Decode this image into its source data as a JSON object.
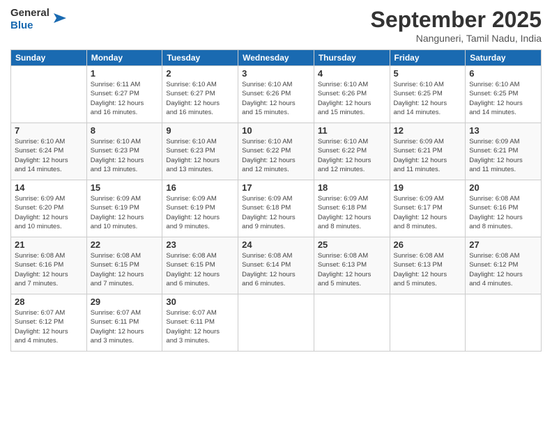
{
  "logo": {
    "general": "General",
    "blue": "Blue"
  },
  "title": "September 2025",
  "subtitle": "Nanguneri, Tamil Nadu, India",
  "days_header": [
    "Sunday",
    "Monday",
    "Tuesday",
    "Wednesday",
    "Thursday",
    "Friday",
    "Saturday"
  ],
  "weeks": [
    [
      {
        "day": "",
        "info": ""
      },
      {
        "day": "1",
        "info": "Sunrise: 6:11 AM\nSunset: 6:27 PM\nDaylight: 12 hours\nand 16 minutes."
      },
      {
        "day": "2",
        "info": "Sunrise: 6:10 AM\nSunset: 6:27 PM\nDaylight: 12 hours\nand 16 minutes."
      },
      {
        "day": "3",
        "info": "Sunrise: 6:10 AM\nSunset: 6:26 PM\nDaylight: 12 hours\nand 15 minutes."
      },
      {
        "day": "4",
        "info": "Sunrise: 6:10 AM\nSunset: 6:26 PM\nDaylight: 12 hours\nand 15 minutes."
      },
      {
        "day": "5",
        "info": "Sunrise: 6:10 AM\nSunset: 6:25 PM\nDaylight: 12 hours\nand 14 minutes."
      },
      {
        "day": "6",
        "info": "Sunrise: 6:10 AM\nSunset: 6:25 PM\nDaylight: 12 hours\nand 14 minutes."
      }
    ],
    [
      {
        "day": "7",
        "info": "Sunrise: 6:10 AM\nSunset: 6:24 PM\nDaylight: 12 hours\nand 14 minutes."
      },
      {
        "day": "8",
        "info": "Sunrise: 6:10 AM\nSunset: 6:23 PM\nDaylight: 12 hours\nand 13 minutes."
      },
      {
        "day": "9",
        "info": "Sunrise: 6:10 AM\nSunset: 6:23 PM\nDaylight: 12 hours\nand 13 minutes."
      },
      {
        "day": "10",
        "info": "Sunrise: 6:10 AM\nSunset: 6:22 PM\nDaylight: 12 hours\nand 12 minutes."
      },
      {
        "day": "11",
        "info": "Sunrise: 6:10 AM\nSunset: 6:22 PM\nDaylight: 12 hours\nand 12 minutes."
      },
      {
        "day": "12",
        "info": "Sunrise: 6:09 AM\nSunset: 6:21 PM\nDaylight: 12 hours\nand 11 minutes."
      },
      {
        "day": "13",
        "info": "Sunrise: 6:09 AM\nSunset: 6:21 PM\nDaylight: 12 hours\nand 11 minutes."
      }
    ],
    [
      {
        "day": "14",
        "info": "Sunrise: 6:09 AM\nSunset: 6:20 PM\nDaylight: 12 hours\nand 10 minutes."
      },
      {
        "day": "15",
        "info": "Sunrise: 6:09 AM\nSunset: 6:19 PM\nDaylight: 12 hours\nand 10 minutes."
      },
      {
        "day": "16",
        "info": "Sunrise: 6:09 AM\nSunset: 6:19 PM\nDaylight: 12 hours\nand 9 minutes."
      },
      {
        "day": "17",
        "info": "Sunrise: 6:09 AM\nSunset: 6:18 PM\nDaylight: 12 hours\nand 9 minutes."
      },
      {
        "day": "18",
        "info": "Sunrise: 6:09 AM\nSunset: 6:18 PM\nDaylight: 12 hours\nand 8 minutes."
      },
      {
        "day": "19",
        "info": "Sunrise: 6:09 AM\nSunset: 6:17 PM\nDaylight: 12 hours\nand 8 minutes."
      },
      {
        "day": "20",
        "info": "Sunrise: 6:08 AM\nSunset: 6:16 PM\nDaylight: 12 hours\nand 8 minutes."
      }
    ],
    [
      {
        "day": "21",
        "info": "Sunrise: 6:08 AM\nSunset: 6:16 PM\nDaylight: 12 hours\nand 7 minutes."
      },
      {
        "day": "22",
        "info": "Sunrise: 6:08 AM\nSunset: 6:15 PM\nDaylight: 12 hours\nand 7 minutes."
      },
      {
        "day": "23",
        "info": "Sunrise: 6:08 AM\nSunset: 6:15 PM\nDaylight: 12 hours\nand 6 minutes."
      },
      {
        "day": "24",
        "info": "Sunrise: 6:08 AM\nSunset: 6:14 PM\nDaylight: 12 hours\nand 6 minutes."
      },
      {
        "day": "25",
        "info": "Sunrise: 6:08 AM\nSunset: 6:13 PM\nDaylight: 12 hours\nand 5 minutes."
      },
      {
        "day": "26",
        "info": "Sunrise: 6:08 AM\nSunset: 6:13 PM\nDaylight: 12 hours\nand 5 minutes."
      },
      {
        "day": "27",
        "info": "Sunrise: 6:08 AM\nSunset: 6:12 PM\nDaylight: 12 hours\nand 4 minutes."
      }
    ],
    [
      {
        "day": "28",
        "info": "Sunrise: 6:07 AM\nSunset: 6:12 PM\nDaylight: 12 hours\nand 4 minutes."
      },
      {
        "day": "29",
        "info": "Sunrise: 6:07 AM\nSunset: 6:11 PM\nDaylight: 12 hours\nand 3 minutes."
      },
      {
        "day": "30",
        "info": "Sunrise: 6:07 AM\nSunset: 6:11 PM\nDaylight: 12 hours\nand 3 minutes."
      },
      {
        "day": "",
        "info": ""
      },
      {
        "day": "",
        "info": ""
      },
      {
        "day": "",
        "info": ""
      },
      {
        "day": "",
        "info": ""
      }
    ]
  ]
}
